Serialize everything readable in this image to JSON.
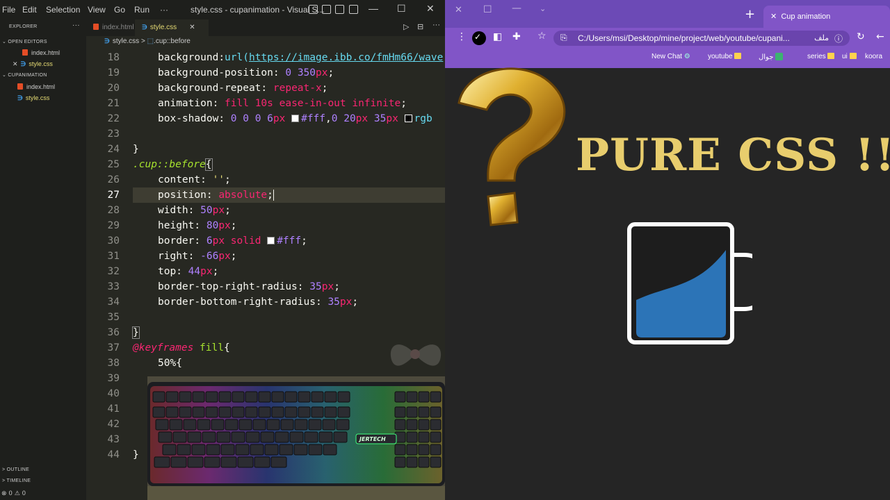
{
  "vscode": {
    "menu": [
      "File",
      "Edit",
      "Selection",
      "View",
      "Go",
      "Run",
      "···"
    ],
    "window_title": "style.css - cupanimation - Visual S...",
    "window_controls": [
      "—",
      "☐",
      "✕"
    ],
    "sidebar": {
      "explorer": "EXPLORER",
      "open_editors": "OPEN EDITORS",
      "open_files": [
        "index.html",
        "style.css"
      ],
      "project": "CUPANIMATION",
      "project_files": [
        "index.html",
        "style.css"
      ],
      "outline": "OUTLINE",
      "timeline": "TIMELINE",
      "status": "⊗ 0 ⚠ 0"
    },
    "tabs": [
      "index.html",
      "style.css"
    ],
    "breadcrumb": {
      "file": "style.css",
      "symbol": ".cup::before"
    },
    "current_line": 27,
    "lines": [
      18,
      19,
      20,
      21,
      22,
      23,
      24,
      25,
      26,
      27,
      28,
      29,
      30,
      31,
      32,
      33,
      34,
      35,
      36,
      37,
      38,
      39,
      40,
      41,
      42,
      43,
      44
    ],
    "code": {
      "bg_url": "https://image.ibb.co/fmHm66/wave",
      "bg_pos_a": "0",
      "bg_pos_b": "350",
      "bg_repeat": "repeat-x",
      "anim": "fill 10s ease-in-out infinite",
      "shadow_a": "0 0 0 6",
      "shadow_col": "#fff",
      "shadow_b": "0 20",
      "shadow_c": "35",
      "shadow_rgb": "rgb",
      "cup_selector": ".cup::before",
      "content_val": "''",
      "position_val": "absolute",
      "width_val": "50",
      "height_val": "80",
      "border_val": "6",
      "border_style": "solid",
      "border_color": "#fff",
      "right_val": "-66",
      "top_val": "44",
      "tr_radius": "35",
      "br_radius": "35",
      "keyframes": "@keyframes",
      "kf_name": "fill",
      "kf_step": "50%{"
    }
  },
  "browser": {
    "tab_title": "Cup animation",
    "new_tab": "+",
    "address": "C:/Users/msi/Desktop/mine/project/web/youtube/cupani...",
    "file_label": "ملف",
    "bookmarks": [
      "New Chat",
      "youtube",
      "جوال",
      "series",
      "ui",
      "koora"
    ],
    "page": {
      "headline": "PURE CSS !!",
      "cup_fill": 0.55
    }
  },
  "colors": {
    "accent": "#8155c7",
    "headline": "#e8cd6d",
    "water": "#2c74b7"
  }
}
